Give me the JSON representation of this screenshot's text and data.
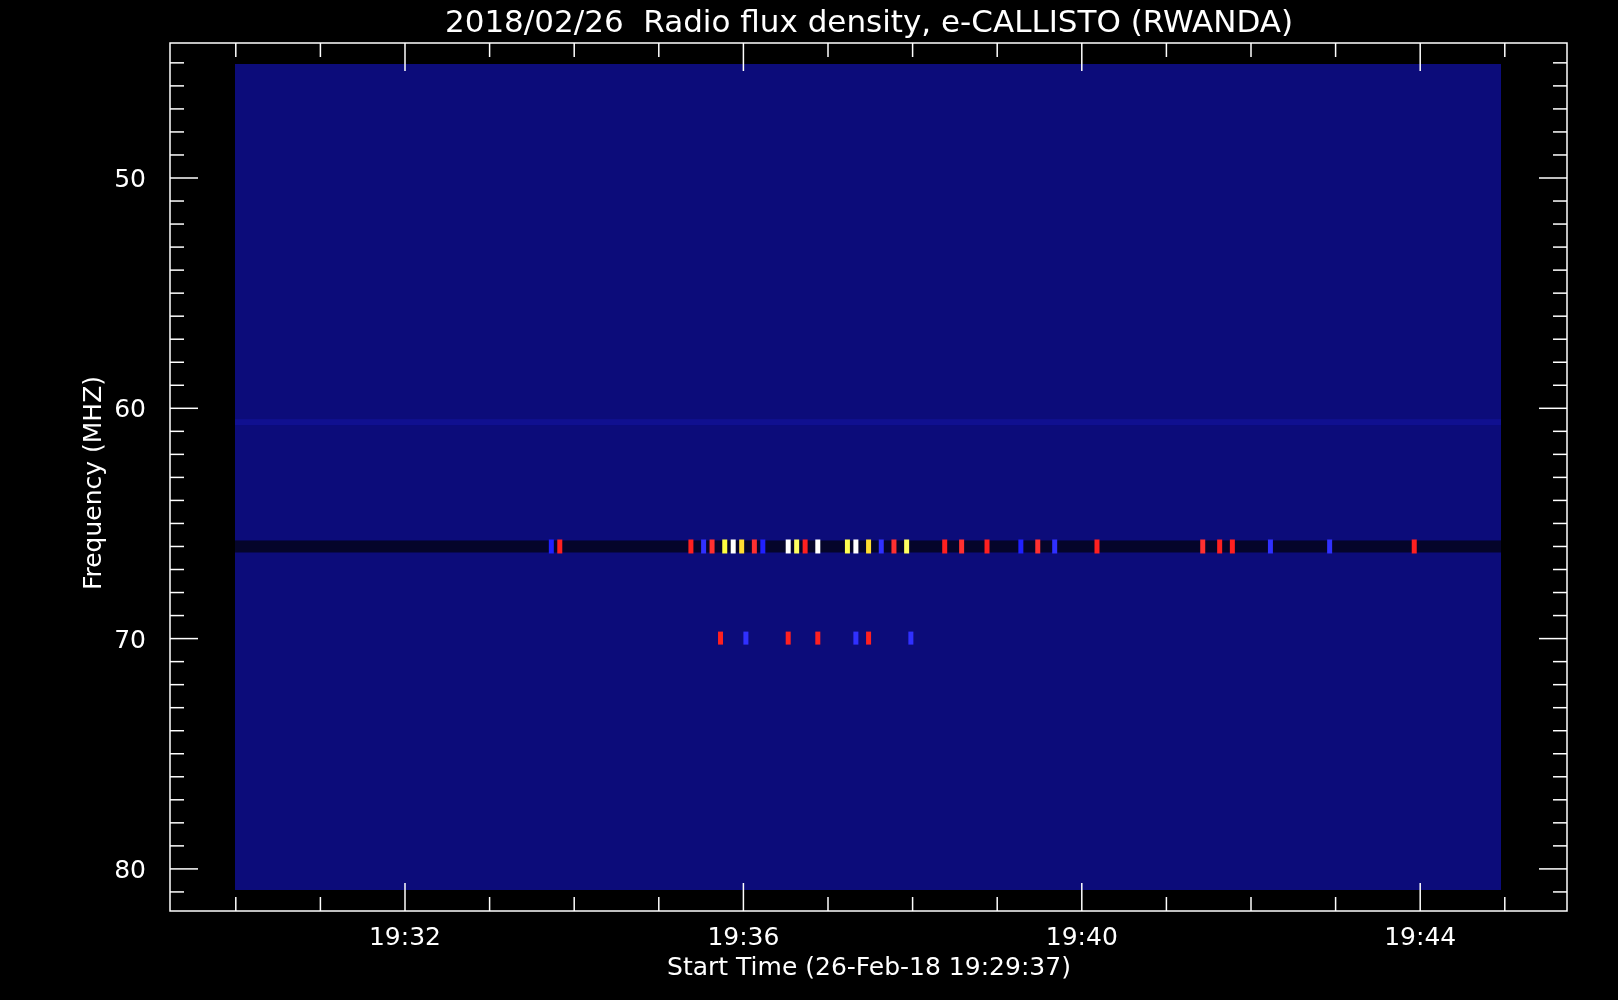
{
  "title": "2018/02/26  Radio flux density, e-CALLISTO (RWANDA)",
  "y_axis": {
    "label": "Frequency (MHZ)",
    "ticks": [
      "50",
      "60",
      "70",
      "80"
    ]
  },
  "x_axis": {
    "label": "Start Time (26-Feb-18 19:29:37)",
    "ticks": [
      "19:32",
      "19:36",
      "19:40",
      "19:44"
    ]
  }
}
